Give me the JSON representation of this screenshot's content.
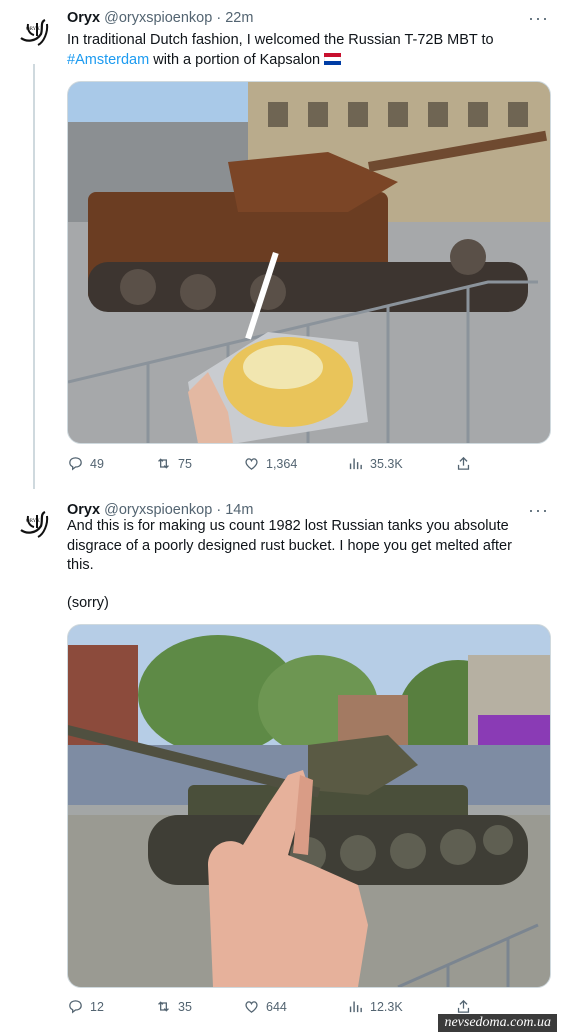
{
  "tweets": [
    {
      "name": "Oryx",
      "handle": "@oryxspioenkop",
      "time": "· 22m",
      "text_before": "In traditional Dutch fashion, I welcomed the Russian T-72B MBT to ",
      "hashtag": "#Amsterdam",
      "text_after": " with a portion of Kapsalon",
      "flag": "netherlands-flag",
      "stats": {
        "replies": "49",
        "retweets": "75",
        "likes": "1,364",
        "views": "35.3K"
      }
    },
    {
      "name": "Oryx",
      "handle": "@oryxspioenkop",
      "time": "· 14m",
      "text": "And this is for making us count 1982 lost Russian tanks you absolute disgrace of a poorly designed rust bucket. I hope you get melted after this.",
      "text2": "(sorry)",
      "stats": {
        "replies": "12",
        "retweets": "35",
        "likes": "644",
        "views": "12.3K"
      }
    }
  ],
  "avatar_text": "ORYX",
  "watermark": "nevsedoma.com.ua",
  "colors": {
    "link": "#1d9bf0",
    "secondary": "#536471",
    "border": "#cfd9de"
  },
  "icons": [
    "reply-icon",
    "retweet-icon",
    "like-icon",
    "views-icon",
    "share-icon",
    "more-icon"
  ]
}
